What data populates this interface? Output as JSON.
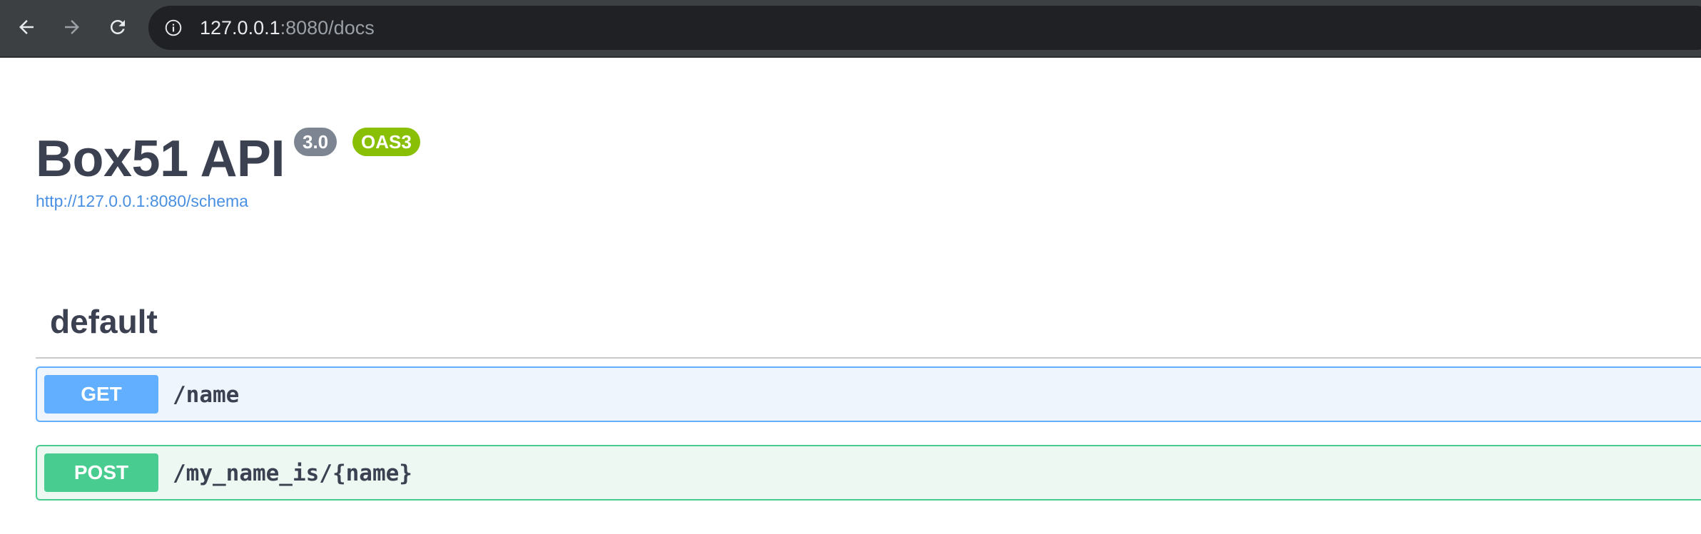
{
  "browser": {
    "url_host": "127.0.0.1",
    "url_rest": ":8080/docs"
  },
  "api": {
    "title": "Box51 API",
    "version_badge": "3.0",
    "spec_badge": "OAS3",
    "schema_link": "http://127.0.0.1:8080/schema"
  },
  "section": {
    "title": "default",
    "operations": [
      {
        "method": "GET",
        "path": "/name",
        "color": "#61affe"
      },
      {
        "method": "POST",
        "path": "/my_name_is/{name}",
        "color": "#49cc90"
      }
    ]
  }
}
